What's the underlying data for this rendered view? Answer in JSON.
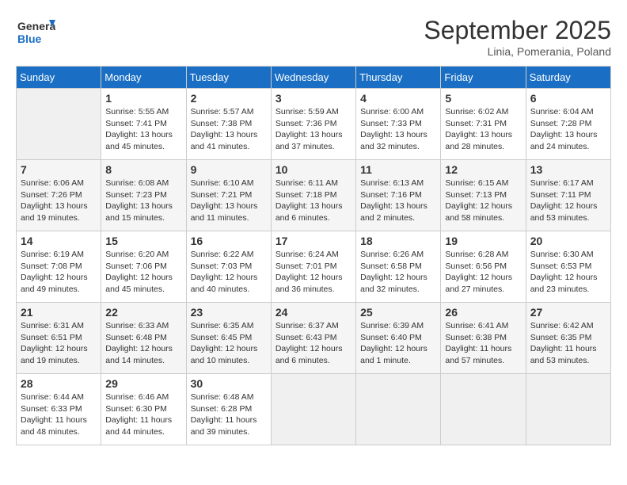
{
  "header": {
    "logo_line1": "General",
    "logo_line2": "Blue",
    "month": "September 2025",
    "location": "Linia, Pomerania, Poland"
  },
  "days_of_week": [
    "Sunday",
    "Monday",
    "Tuesday",
    "Wednesday",
    "Thursday",
    "Friday",
    "Saturday"
  ],
  "weeks": [
    [
      {
        "day": "",
        "info": ""
      },
      {
        "day": "1",
        "info": "Sunrise: 5:55 AM\nSunset: 7:41 PM\nDaylight: 13 hours\nand 45 minutes."
      },
      {
        "day": "2",
        "info": "Sunrise: 5:57 AM\nSunset: 7:38 PM\nDaylight: 13 hours\nand 41 minutes."
      },
      {
        "day": "3",
        "info": "Sunrise: 5:59 AM\nSunset: 7:36 PM\nDaylight: 13 hours\nand 37 minutes."
      },
      {
        "day": "4",
        "info": "Sunrise: 6:00 AM\nSunset: 7:33 PM\nDaylight: 13 hours\nand 32 minutes."
      },
      {
        "day": "5",
        "info": "Sunrise: 6:02 AM\nSunset: 7:31 PM\nDaylight: 13 hours\nand 28 minutes."
      },
      {
        "day": "6",
        "info": "Sunrise: 6:04 AM\nSunset: 7:28 PM\nDaylight: 13 hours\nand 24 minutes."
      }
    ],
    [
      {
        "day": "7",
        "info": "Sunrise: 6:06 AM\nSunset: 7:26 PM\nDaylight: 13 hours\nand 19 minutes."
      },
      {
        "day": "8",
        "info": "Sunrise: 6:08 AM\nSunset: 7:23 PM\nDaylight: 13 hours\nand 15 minutes."
      },
      {
        "day": "9",
        "info": "Sunrise: 6:10 AM\nSunset: 7:21 PM\nDaylight: 13 hours\nand 11 minutes."
      },
      {
        "day": "10",
        "info": "Sunrise: 6:11 AM\nSunset: 7:18 PM\nDaylight: 13 hours\nand 6 minutes."
      },
      {
        "day": "11",
        "info": "Sunrise: 6:13 AM\nSunset: 7:16 PM\nDaylight: 13 hours\nand 2 minutes."
      },
      {
        "day": "12",
        "info": "Sunrise: 6:15 AM\nSunset: 7:13 PM\nDaylight: 12 hours\nand 58 minutes."
      },
      {
        "day": "13",
        "info": "Sunrise: 6:17 AM\nSunset: 7:11 PM\nDaylight: 12 hours\nand 53 minutes."
      }
    ],
    [
      {
        "day": "14",
        "info": "Sunrise: 6:19 AM\nSunset: 7:08 PM\nDaylight: 12 hours\nand 49 minutes."
      },
      {
        "day": "15",
        "info": "Sunrise: 6:20 AM\nSunset: 7:06 PM\nDaylight: 12 hours\nand 45 minutes."
      },
      {
        "day": "16",
        "info": "Sunrise: 6:22 AM\nSunset: 7:03 PM\nDaylight: 12 hours\nand 40 minutes."
      },
      {
        "day": "17",
        "info": "Sunrise: 6:24 AM\nSunset: 7:01 PM\nDaylight: 12 hours\nand 36 minutes."
      },
      {
        "day": "18",
        "info": "Sunrise: 6:26 AM\nSunset: 6:58 PM\nDaylight: 12 hours\nand 32 minutes."
      },
      {
        "day": "19",
        "info": "Sunrise: 6:28 AM\nSunset: 6:56 PM\nDaylight: 12 hours\nand 27 minutes."
      },
      {
        "day": "20",
        "info": "Sunrise: 6:30 AM\nSunset: 6:53 PM\nDaylight: 12 hours\nand 23 minutes."
      }
    ],
    [
      {
        "day": "21",
        "info": "Sunrise: 6:31 AM\nSunset: 6:51 PM\nDaylight: 12 hours\nand 19 minutes."
      },
      {
        "day": "22",
        "info": "Sunrise: 6:33 AM\nSunset: 6:48 PM\nDaylight: 12 hours\nand 14 minutes."
      },
      {
        "day": "23",
        "info": "Sunrise: 6:35 AM\nSunset: 6:45 PM\nDaylight: 12 hours\nand 10 minutes."
      },
      {
        "day": "24",
        "info": "Sunrise: 6:37 AM\nSunset: 6:43 PM\nDaylight: 12 hours\nand 6 minutes."
      },
      {
        "day": "25",
        "info": "Sunrise: 6:39 AM\nSunset: 6:40 PM\nDaylight: 12 hours\nand 1 minute."
      },
      {
        "day": "26",
        "info": "Sunrise: 6:41 AM\nSunset: 6:38 PM\nDaylight: 11 hours\nand 57 minutes."
      },
      {
        "day": "27",
        "info": "Sunrise: 6:42 AM\nSunset: 6:35 PM\nDaylight: 11 hours\nand 53 minutes."
      }
    ],
    [
      {
        "day": "28",
        "info": "Sunrise: 6:44 AM\nSunset: 6:33 PM\nDaylight: 11 hours\nand 48 minutes."
      },
      {
        "day": "29",
        "info": "Sunrise: 6:46 AM\nSunset: 6:30 PM\nDaylight: 11 hours\nand 44 minutes."
      },
      {
        "day": "30",
        "info": "Sunrise: 6:48 AM\nSunset: 6:28 PM\nDaylight: 11 hours\nand 39 minutes."
      },
      {
        "day": "",
        "info": ""
      },
      {
        "day": "",
        "info": ""
      },
      {
        "day": "",
        "info": ""
      },
      {
        "day": "",
        "info": ""
      }
    ]
  ]
}
